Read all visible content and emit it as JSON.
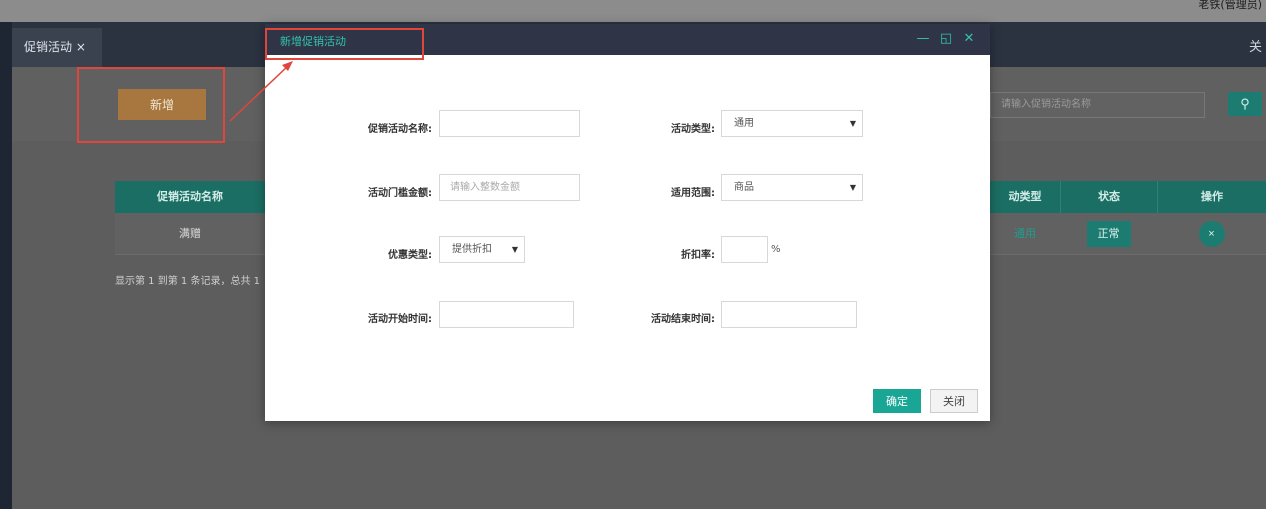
{
  "topbar": {
    "user": "老铁(管理员)"
  },
  "tabs": {
    "active": "促销活动 ×",
    "right_glyph": "关"
  },
  "toolbar": {
    "add_label": "新增",
    "search_placeholder": "请输入促销活动名称"
  },
  "table": {
    "headers": {
      "name": "促销活动名称",
      "type": "动类型",
      "state": "状态",
      "op": "操作"
    },
    "rows": [
      {
        "name": "满赠",
        "type": "通用",
        "state": "正常",
        "op": "×"
      }
    ],
    "pager": "显示第 1 到第 1 条记录，总共 1"
  },
  "modal": {
    "title": "新增促销活动",
    "fields": {
      "name_label": "促销活动名称:",
      "type_label": "活动类型:",
      "type_value": "通用",
      "threshold_label": "活动门槛金额:",
      "threshold_placeholder": "请输入整数金额",
      "scope_label": "适用范围:",
      "scope_value": "商品",
      "discount_type_label": "优惠类型:",
      "discount_type_value": "提供折扣",
      "rate_label": "折扣率:",
      "rate_unit": "%",
      "start_label": "活动开始时间:",
      "end_label": "活动结束时间:"
    },
    "ok_label": "确定",
    "close_label": "关闭"
  },
  "colors": {
    "accent": "#1aa694",
    "header": "#2f3546",
    "highlight": "#e0463c"
  }
}
